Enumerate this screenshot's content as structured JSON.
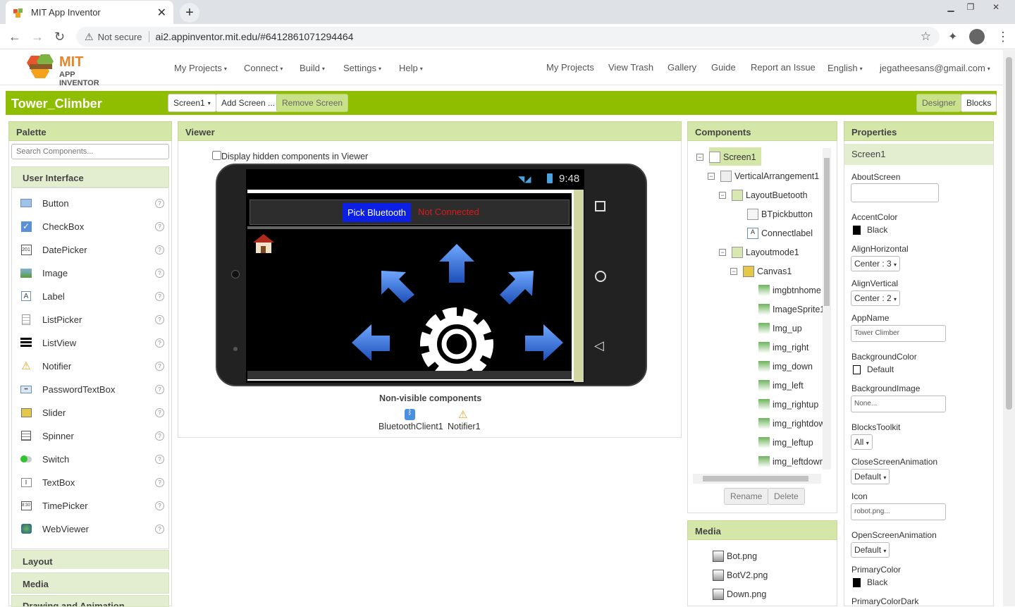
{
  "browser": {
    "tab_title": "MIT App Inventor",
    "not_secure": "Not secure",
    "url": "ai2.appinventor.mit.edu/#6412861071294464"
  },
  "header": {
    "logo_line1": "MIT",
    "logo_line2": "APP INVENTOR",
    "menus": [
      "My Projects",
      "Connect",
      "Build",
      "Settings",
      "Help"
    ],
    "links": [
      "My Projects",
      "View Trash",
      "Gallery",
      "Guide",
      "Report an Issue"
    ],
    "language": "English",
    "account": "jegatheesans@gmail.com"
  },
  "project": {
    "name": "Tower_Climber",
    "screen_select": "Screen1",
    "add_screen": "Add Screen ...",
    "remove_screen": "Remove Screen",
    "designer": "Designer",
    "blocks": "Blocks"
  },
  "palette": {
    "title": "Palette",
    "search_placeholder": "Search Components...",
    "category_open": "User Interface",
    "items": [
      "Button",
      "CheckBox",
      "DatePicker",
      "Image",
      "Label",
      "ListPicker",
      "ListView",
      "Notifier",
      "PasswordTextBox",
      "Slider",
      "Spinner",
      "Switch",
      "TextBox",
      "TimePicker",
      "WebViewer"
    ],
    "categories": [
      "Layout",
      "Media",
      "Drawing and Animation"
    ],
    "help_glyph": "?"
  },
  "viewer": {
    "title": "Viewer",
    "hidden_label": "Display hidden components in Viewer",
    "time": "9:48",
    "pick_bt": "Pick Bluetooth",
    "not_connected": "Not Connected",
    "nonvisible_title": "Non-visible components",
    "nonvisible": [
      "BluetoothClient1",
      "Notifier1"
    ]
  },
  "components": {
    "title": "Components",
    "tree": [
      "Screen1",
      "VerticalArrangement1",
      "LayoutBuetooth",
      "BTpickbutton",
      "Connectlabel",
      "Layoutmode1",
      "Canvas1",
      "imgbtnhome",
      "ImageSprite1",
      "Img_up",
      "img_right",
      "img_down",
      "img_left",
      "img_rightup",
      "img_rightdow",
      "img_leftup",
      "img_leftdown"
    ],
    "rename": "Rename",
    "delete": "Delete"
  },
  "media": {
    "title": "Media",
    "files": [
      "Bot.png",
      "BotV2.png",
      "Down.png"
    ]
  },
  "properties": {
    "title": "Properties",
    "component": "Screen1",
    "about": "AboutScreen",
    "accent_label": "AccentColor",
    "accent_value": "Black",
    "alignh_label": "AlignHorizontal",
    "alignh_value": "Center : 3",
    "alignv_label": "AlignVertical",
    "alignv_value": "Center : 2",
    "appname_label": "AppName",
    "appname_value": "Tower Climber",
    "bgcolor_label": "BackgroundColor",
    "bgcolor_value": "Default",
    "bgimage_label": "BackgroundImage",
    "bgimage_value": "None...",
    "toolkit_label": "BlocksToolkit",
    "toolkit_value": "All",
    "close_label": "CloseScreenAnimation",
    "close_value": "Default",
    "icon_label": "Icon",
    "icon_value": "robot.png...",
    "open_label": "OpenScreenAnimation",
    "open_value": "Default",
    "primary_label": "PrimaryColor",
    "primary_value": "Black",
    "primarydark_label": "PrimaryColorDark"
  }
}
